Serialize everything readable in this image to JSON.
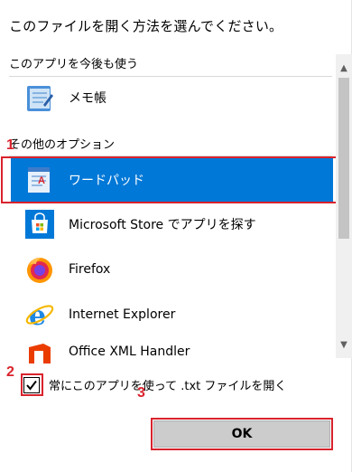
{
  "dialog": {
    "title": "このファイルを開く方法を選んでください。"
  },
  "recent_section": {
    "label": "このアプリを今後も使う",
    "apps": [
      {
        "name": "メモ帳",
        "icon": "notepad-icon"
      }
    ]
  },
  "other_section": {
    "label": "その他のオプション",
    "apps": [
      {
        "name": "ワードパッド",
        "icon": "wordpad-icon",
        "selected": true
      },
      {
        "name": "Microsoft Store でアプリを探す",
        "icon": "store-icon"
      },
      {
        "name": "Firefox",
        "icon": "firefox-icon"
      },
      {
        "name": "Internet Explorer",
        "icon": "internet-explorer-icon"
      },
      {
        "name": "Office XML Handler",
        "icon": "office-icon"
      }
    ]
  },
  "always_use": {
    "label": "常にこのアプリを使って .txt ファイルを開く",
    "checked": true
  },
  "ok_button": {
    "label": "OK"
  },
  "annotations": {
    "step1": "1",
    "step2": "2",
    "step3": "3"
  },
  "colors": {
    "selection": "#0078d7",
    "annotation": "#d9232d"
  }
}
